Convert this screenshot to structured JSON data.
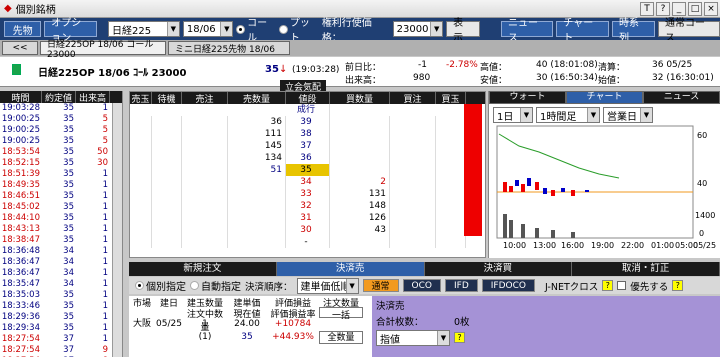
{
  "window": {
    "title": "個別銘柄",
    "title_icons": [
      "T",
      "?",
      "_",
      "□",
      "×"
    ]
  },
  "toolbar": {
    "btn_sakimono": "先物",
    "btn_option": "オプション",
    "sel_index": "日経225",
    "sel_month": "18/06",
    "radio_call": "コール",
    "radio_put": "プット",
    "strike_label": "権利行使価格：",
    "strike_value": "23000",
    "btn_show": "表示",
    "btn_news": "ニュース",
    "btn_chart": "チャート",
    "btn_timeseries": "時系列",
    "btn_normal_course": "通常コース"
  },
  "tabs": [
    "<<",
    "日経225OP 18/06 コール 23000",
    "ミニ日経225先物 18/06"
  ],
  "info": {
    "name": "日経225OP 18/06 ｺｰﾙ 23000",
    "price": "35",
    "arrow": "↓",
    "time": "(19:03:28)",
    "prev_label": "前日比：",
    "prev_val": "-1",
    "prev_pct": "-2.78%",
    "vol_label": "出来高：",
    "vol_val": "980",
    "high_label": "高値：",
    "high_val": "40 (18:01:08)",
    "low_label": "安値：",
    "low_val": "30 (16:50:34)",
    "settle_label": "清算：",
    "settle_val": "36 05/25",
    "open_label": "始値：",
    "open_val": "32 (16:30:01)",
    "status": "立会気配"
  },
  "timesale": {
    "headers": [
      "時間",
      "約定値",
      "出来高"
    ],
    "rows": [
      [
        "19:03:28",
        "35",
        "1"
      ],
      [
        "19:00:25",
        "35",
        "5"
      ],
      [
        "19:00:25",
        "35",
        "5"
      ],
      [
        "19:00:25",
        "35",
        "5"
      ],
      [
        "18:53:54",
        "35",
        "50"
      ],
      [
        "18:52:15",
        "35",
        "30"
      ],
      [
        "18:51:39",
        "35",
        "1"
      ],
      [
        "18:49:35",
        "35",
        "1"
      ],
      [
        "18:46:51",
        "35",
        "1"
      ],
      [
        "18:45:02",
        "35",
        "1"
      ],
      [
        "18:44:10",
        "35",
        "1"
      ],
      [
        "18:43:13",
        "35",
        "1"
      ],
      [
        "18:38:47",
        "35",
        "1"
      ],
      [
        "18:36:48",
        "34",
        "1"
      ],
      [
        "18:36:47",
        "34",
        "1"
      ],
      [
        "18:36:47",
        "34",
        "1"
      ],
      [
        "18:35:47",
        "34",
        "1"
      ],
      [
        "18:35:03",
        "35",
        "1"
      ],
      [
        "18:33:46",
        "35",
        "1"
      ],
      [
        "18:29:36",
        "35",
        "1"
      ],
      [
        "18:29:34",
        "35",
        "1"
      ],
      [
        "18:27:54",
        "37",
        "1"
      ],
      [
        "18:27:54",
        "37",
        "9"
      ],
      [
        "18:27:54",
        "37",
        "8"
      ]
    ]
  },
  "board": {
    "headers": [
      "売玉",
      "待機",
      "売注",
      "売数量",
      "値段",
      "買数量",
      "買注",
      "買玉"
    ],
    "market_label": "成行",
    "rows": [
      {
        "sell": "36",
        "price": "39",
        "buy": ""
      },
      {
        "sell": "111",
        "price": "38",
        "buy": ""
      },
      {
        "sell": "145",
        "price": "37",
        "buy": ""
      },
      {
        "sell": "134",
        "price": "36",
        "buy": ""
      },
      {
        "sell": "51",
        "price": "35",
        "buy": ""
      },
      {
        "sell": "",
        "price": "34",
        "buy": "2"
      },
      {
        "sell": "",
        "price": "33",
        "buy": "131"
      },
      {
        "sell": "",
        "price": "32",
        "buy": "148"
      },
      {
        "sell": "",
        "price": "31",
        "buy": "126"
      },
      {
        "sell": "",
        "price": "30",
        "buy": "43"
      },
      {
        "sell": "",
        "price": "-",
        "buy": ""
      }
    ],
    "bottom_left": "1",
    "bottom_right": "M"
  },
  "chart": {
    "tabs": [
      "ウォート",
      "チャート",
      "ニュース"
    ],
    "sel_period": "1日",
    "sel_interval": "1時間足",
    "sel_session": "営業日",
    "ticks_y": [
      "60",
      "40",
      "1400",
      "0"
    ],
    "ticks_x": [
      "10:00",
      "13:00",
      "16:00",
      "19:00",
      "22:00",
      "01:00",
      "05:00",
      "05/25"
    ]
  },
  "chart_data": {
    "type": "line",
    "title": "",
    "x": [
      "10:00",
      "13:00",
      "16:00",
      "19:00"
    ],
    "series": [],
    "ylim": [
      20,
      70
    ]
  },
  "order": {
    "tabs": [
      "新規注文",
      "決済売",
      "決済買",
      "取消・訂正"
    ],
    "radio_individual": "個別指定",
    "radio_auto": "自動指定",
    "order_label": "決済順序：",
    "order_sel": "建単価低順",
    "btns": [
      "通常",
      "OCO",
      "IFD",
      "IFDOCO"
    ],
    "jnet": "J-NETクロス",
    "priority": "優先する",
    "pos_headers": [
      "市場",
      "建日",
      "建玉数量",
      "建単価",
      "評価損益",
      "注文数量"
    ],
    "pos_headers2": [
      "",
      "",
      "注文中数量",
      "現在値",
      "評価損益率",
      ""
    ],
    "pos_row": [
      "大阪",
      "05/25",
      "1",
      "24.00",
      "+10784",
      "一括"
    ],
    "pos_row2": [
      "",
      "",
      "(1)",
      "35",
      "+44.93%",
      "全数量"
    ],
    "form_title": "決済売",
    "total_label": "合計枚数：",
    "total_val": "0枚",
    "price_type": "指値"
  }
}
